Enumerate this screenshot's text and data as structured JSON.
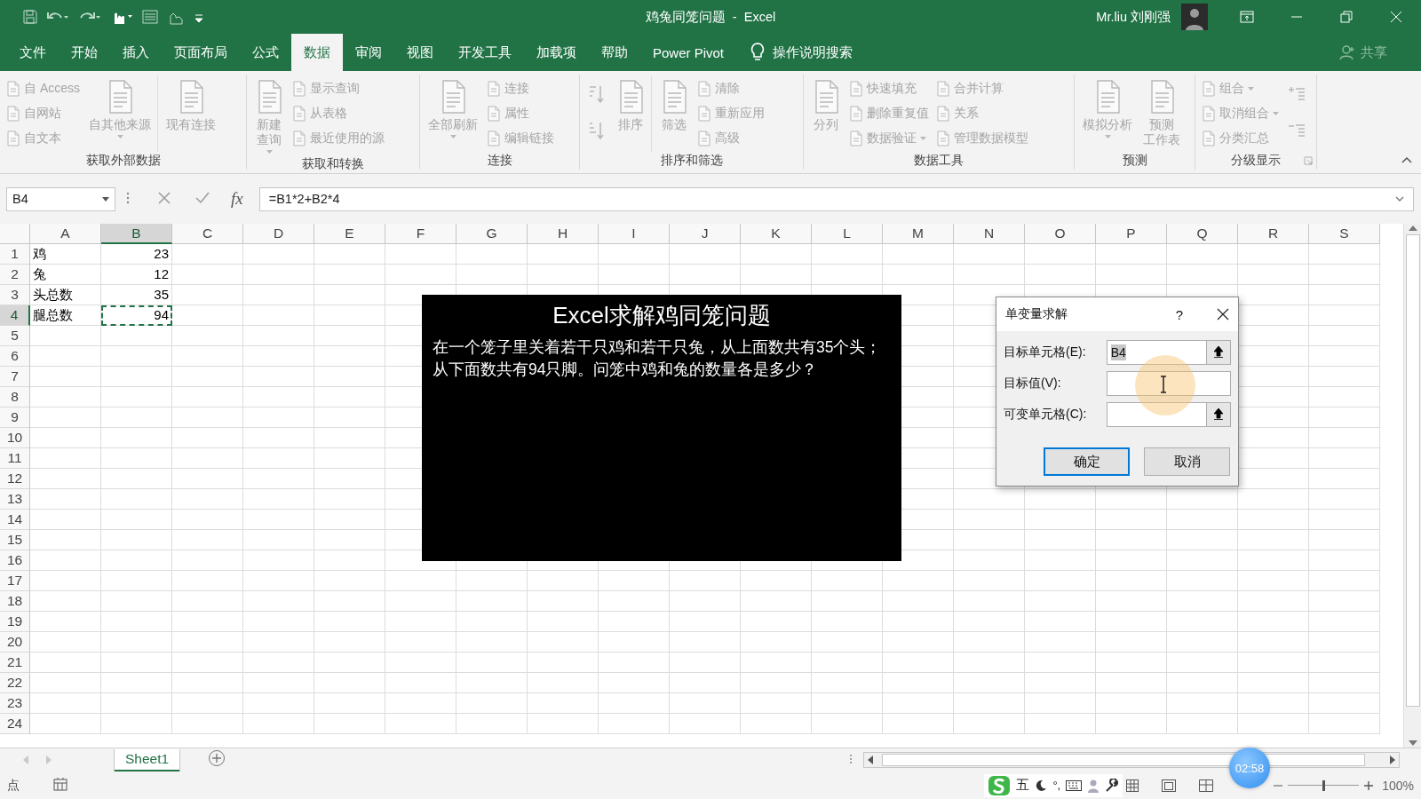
{
  "title_bar": {
    "title": "鸡兔同笼问题  -  Excel",
    "user": "Mr.liu 刘刚强"
  },
  "ribbon_tabs": [
    {
      "label": "文件",
      "selected": false
    },
    {
      "label": "开始",
      "selected": false
    },
    {
      "label": "插入",
      "selected": false
    },
    {
      "label": "页面布局",
      "selected": false
    },
    {
      "label": "公式",
      "selected": false
    },
    {
      "label": "数据",
      "selected": true
    },
    {
      "label": "审阅",
      "selected": false
    },
    {
      "label": "视图",
      "selected": false
    },
    {
      "label": "开发工具",
      "selected": false
    },
    {
      "label": "加载项",
      "selected": false
    },
    {
      "label": "帮助",
      "selected": false
    },
    {
      "label": "Power Pivot",
      "selected": false
    }
  ],
  "tell_me": "操作说明搜索",
  "share": "共享",
  "ribbon_groups": [
    {
      "label": "获取外部数据",
      "launcher": false,
      "columns": [
        {
          "divider": false,
          "buttons": [
            {
              "kind": "small",
              "label": "自 Access",
              "disabled": true,
              "dropdown": false
            },
            {
              "kind": "small",
              "label": "自网站",
              "disabled": true,
              "dropdown": false
            },
            {
              "kind": "small",
              "label": "自文本",
              "disabled": true,
              "dropdown": false
            }
          ]
        },
        {
          "divider": false,
          "buttons": [
            {
              "kind": "large",
              "label": "自其他来源",
              "disabled": true,
              "dropdown": true
            }
          ]
        },
        {
          "divider": true,
          "buttons": [
            {
              "kind": "large",
              "label": "现有连接",
              "disabled": true,
              "dropdown": false
            }
          ]
        }
      ]
    },
    {
      "label": "获取和转换",
      "launcher": false,
      "columns": [
        {
          "divider": false,
          "buttons": [
            {
              "kind": "large",
              "label": [
                "新建",
                "查询"
              ],
              "disabled": true,
              "dropdown": true
            }
          ]
        },
        {
          "divider": false,
          "buttons": [
            {
              "kind": "small",
              "label": "显示查询",
              "disabled": true,
              "dropdown": false
            },
            {
              "kind": "small",
              "label": "从表格",
              "disabled": true,
              "dropdown": false
            },
            {
              "kind": "small",
              "label": "最近使用的源",
              "disabled": true,
              "dropdown": false
            }
          ]
        }
      ]
    },
    {
      "label": "连接",
      "launcher": false,
      "columns": [
        {
          "divider": false,
          "buttons": [
            {
              "kind": "large",
              "label": "全部刷新",
              "disabled": true,
              "dropdown": true
            }
          ]
        },
        {
          "divider": false,
          "buttons": [
            {
              "kind": "small",
              "label": "连接",
              "disabled": true,
              "dropdown": false
            },
            {
              "kind": "small",
              "label": "属性",
              "disabled": true,
              "dropdown": false
            },
            {
              "kind": "small",
              "label": "编辑链接",
              "disabled": true,
              "dropdown": false
            }
          ]
        }
      ]
    },
    {
      "label": "排序和筛选",
      "launcher": false,
      "columns": [
        {
          "divider": false,
          "buttons": [
            {
              "kind": "sort-az",
              "disabled": true,
              "dropdown": false
            },
            {
              "kind": "sort-za",
              "disabled": true,
              "dropdown": false
            }
          ]
        },
        {
          "divider": false,
          "buttons": [
            {
              "kind": "large",
              "label": "排序",
              "disabled": true,
              "dropdown": false
            }
          ]
        },
        {
          "divider": true,
          "buttons": [
            {
              "kind": "large",
              "label": "筛选",
              "disabled": true,
              "dropdown": false
            }
          ]
        },
        {
          "divider": false,
          "buttons": [
            {
              "kind": "small",
              "label": "清除",
              "disabled": true,
              "dropdown": false
            },
            {
              "kind": "small",
              "label": "重新应用",
              "disabled": true,
              "dropdown": false
            },
            {
              "kind": "small",
              "label": "高级",
              "disabled": true,
              "dropdown": false
            }
          ]
        }
      ]
    },
    {
      "label": "数据工具",
      "launcher": false,
      "columns": [
        {
          "divider": false,
          "buttons": [
            {
              "kind": "large",
              "label": "分列",
              "disabled": true,
              "dropdown": false
            }
          ]
        },
        {
          "divider": false,
          "buttons": [
            {
              "kind": "small",
              "label": "快速填充",
              "disabled": true,
              "dropdown": false
            },
            {
              "kind": "small",
              "label": "删除重复值",
              "disabled": true,
              "dropdown": false
            },
            {
              "kind": "small",
              "label": "数据验证",
              "disabled": true,
              "dropdown": true
            }
          ]
        },
        {
          "divider": false,
          "buttons": [
            {
              "kind": "small",
              "label": "合并计算",
              "disabled": true,
              "dropdown": false
            },
            {
              "kind": "small",
              "label": "关系",
              "disabled": true,
              "dropdown": false
            },
            {
              "kind": "small",
              "label": "管理数据模型",
              "disabled": true,
              "dropdown": false
            }
          ]
        }
      ]
    },
    {
      "label": "预测",
      "launcher": false,
      "columns": [
        {
          "divider": false,
          "buttons": [
            {
              "kind": "large",
              "label": "模拟分析",
              "disabled": true,
              "dropdown": true
            }
          ]
        },
        {
          "divider": false,
          "buttons": [
            {
              "kind": "large",
              "label": [
                "预测",
                "工作表"
              ],
              "disabled": true,
              "dropdown": false
            }
          ]
        }
      ]
    },
    {
      "label": "分级显示",
      "launcher": true,
      "columns": [
        {
          "divider": false,
          "buttons": [
            {
              "kind": "small",
              "label": "组合",
              "disabled": true,
              "dropdown": true
            },
            {
              "kind": "small",
              "label": "取消组合",
              "disabled": true,
              "dropdown": true
            },
            {
              "kind": "small",
              "label": "分类汇总",
              "disabled": true,
              "dropdown": false
            }
          ]
        },
        {
          "divider": false,
          "buttons": [
            {
              "kind": "show-detail",
              "disabled": true,
              "dropdown": false
            },
            {
              "kind": "hide-detail",
              "disabled": true,
              "dropdown": false
            }
          ]
        }
      ]
    }
  ],
  "formula_bar": {
    "name_box": "B4",
    "function_button": "fx",
    "formula": "=B1*2+B2*4"
  },
  "grid": {
    "columns": [
      {
        "label": "A",
        "selected": false
      },
      {
        "label": "B",
        "selected": true
      },
      {
        "label": "C",
        "selected": false
      },
      {
        "label": "D",
        "selected": false
      },
      {
        "label": "E",
        "selected": false
      },
      {
        "label": "F",
        "selected": false
      },
      {
        "label": "G",
        "selected": false
      },
      {
        "label": "H",
        "selected": false
      },
      {
        "label": "I",
        "selected": false
      },
      {
        "label": "J",
        "selected": false
      },
      {
        "label": "K",
        "selected": false
      },
      {
        "label": "L",
        "selected": false
      },
      {
        "label": "M",
        "selected": false
      },
      {
        "label": "N",
        "selected": false
      },
      {
        "label": "O",
        "selected": false
      },
      {
        "label": "P",
        "selected": false
      },
      {
        "label": "Q",
        "selected": false
      },
      {
        "label": "R",
        "selected": false
      },
      {
        "label": "S",
        "selected": false
      }
    ],
    "row_headers": [
      {
        "label": "1",
        "selected": false
      },
      {
        "label": "2",
        "selected": false
      },
      {
        "label": "3",
        "selected": false
      },
      {
        "label": "4",
        "selected": true
      },
      {
        "label": "5",
        "selected": false
      },
      {
        "label": "6",
        "selected": false
      },
      {
        "label": "7",
        "selected": false
      },
      {
        "label": "8",
        "selected": false
      },
      {
        "label": "9",
        "selected": false
      },
      {
        "label": "10",
        "selected": false
      },
      {
        "label": "11",
        "selected": false
      },
      {
        "label": "12",
        "selected": false
      },
      {
        "label": "13",
        "selected": false
      },
      {
        "label": "14",
        "selected": false
      },
      {
        "label": "15",
        "selected": false
      },
      {
        "label": "16",
        "selected": false
      },
      {
        "label": "17",
        "selected": false
      },
      {
        "label": "18",
        "selected": false
      },
      {
        "label": "19",
        "selected": false
      },
      {
        "label": "20",
        "selected": false
      },
      {
        "label": "21",
        "selected": false
      },
      {
        "label": "22",
        "selected": false
      },
      {
        "label": "23",
        "selected": false
      },
      {
        "label": "24",
        "selected": false
      }
    ],
    "rows": [
      {
        "cells": [
          {
            "text": "鸡",
            "kind": "text",
            "marquee": false
          },
          {
            "text": "23",
            "kind": "number",
            "marquee": false
          }
        ]
      },
      {
        "cells": [
          {
            "text": "兔",
            "kind": "text",
            "marquee": false
          },
          {
            "text": "12",
            "kind": "number",
            "marquee": false
          }
        ]
      },
      {
        "cells": [
          {
            "text": "头总数",
            "kind": "text",
            "marquee": false
          },
          {
            "text": "35",
            "kind": "number",
            "marquee": false
          }
        ]
      },
      {
        "cells": [
          {
            "text": "腿总数",
            "kind": "text",
            "marquee": false
          },
          {
            "text": "94",
            "kind": "number",
            "marquee": true
          }
        ]
      }
    ]
  },
  "text_box": {
    "title": "Excel求解鸡同笼问题",
    "body": "在一个笼子里关着若干只鸡和若干只兔，从上面数共有35个头；从下面数共有94只脚。问笼中鸡和兔的数量各是多少？"
  },
  "dialog": {
    "title": "单变量求解",
    "help": "?",
    "fields": [
      {
        "label": "目标单元格(E):",
        "value": "B4",
        "value_selected": true,
        "range_picker": true
      },
      {
        "label": "目标值(V):",
        "value_selected": false,
        "range_picker": false
      },
      {
        "label": "可变单元格(C):",
        "value_selected": false,
        "range_picker": true
      }
    ],
    "buttons": [
      {
        "label": "确定",
        "default": true
      },
      {
        "label": "取消",
        "default": false
      }
    ]
  },
  "sheet_tabs": [
    {
      "label": "Sheet1",
      "selected": true
    }
  ],
  "status_bar": {
    "mode": "点",
    "ime_mode": "五",
    "ime_punctuation": "°,",
    "zoom": "100%",
    "zoom_slider": {
      "level": 0.5
    }
  },
  "recording_timer": "02:58"
}
